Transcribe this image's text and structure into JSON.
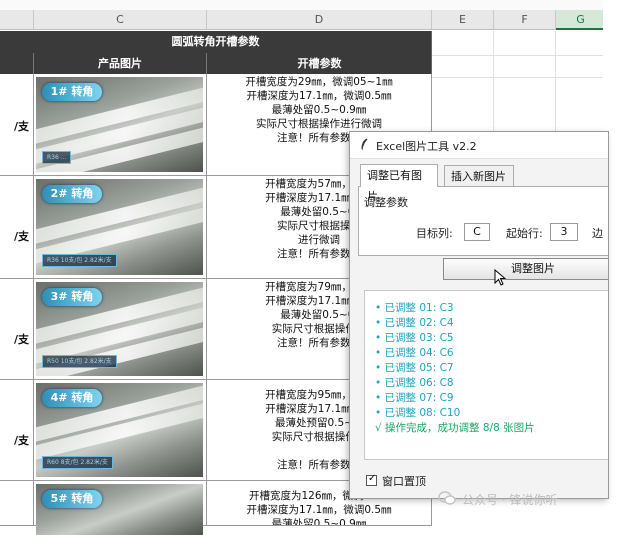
{
  "columns": [
    "C",
    "D",
    "E",
    "F",
    "G"
  ],
  "sheet": {
    "title": "圆弧转角开槽参数",
    "header_image": "产品图片",
    "header_params": "开槽参数",
    "price_suffix": "/支",
    "rows": [
      {
        "badge": "1# 转角",
        "spec": "R36 ...",
        "params": [
          "开槽宽度为29㎜，微调05~1㎜",
          "开槽深度为17.1㎜，微调0.5㎜",
          "最薄处留0.5~0.9㎜",
          "实际尺寸根据操作进行微调",
          "注意！所有参数仅"
        ]
      },
      {
        "badge": "2# 转角",
        "spec": "R36   10支/包  2.82米/支",
        "params": [
          "开槽宽度为57㎜，微调",
          "开槽深度为17.1㎜，微",
          "最薄处留0.5~0.",
          "实际尺寸根据操作",
          "进行微调",
          "注意！所有参数仅"
        ]
      },
      {
        "badge": "3# 转角",
        "spec": "R50   10支/包  2.82米/支",
        "params": [
          "开槽宽度为79㎜，微调",
          "开槽深度为17.1㎜，微",
          "最薄处留0.5~0.",
          "实际尺寸根据操作进",
          "注意！所有参数仅"
        ]
      },
      {
        "badge": "4# 转角",
        "spec": "R60   8支/包  2.82米/支",
        "params": [
          "开槽宽度为95㎜，微调",
          "开槽深度为17.1㎜，微",
          "最薄处预留0.5~0.",
          "实际尺寸根据操作进",
          "",
          "注意！所有参数仅"
        ]
      },
      {
        "badge": "5# 转角",
        "spec": "",
        "params": [
          "开槽宽度为126㎜，微调0.5~",
          "开槽深度为17.1㎜，微调0.5㎜",
          "最薄处留0.5~0.9㎜"
        ]
      }
    ]
  },
  "dialog": {
    "title": "Excel图片工具 v2.2",
    "tabs": [
      "调整已有图片",
      "插入新图片"
    ],
    "group_label": "调整参数",
    "target_col_label": "目标列:",
    "target_col_value": "C",
    "start_row_label": "起始行:",
    "start_row_value": "3",
    "extra_label": "边",
    "button_label": "调整图片",
    "log": [
      "• 已调整 01: C3",
      "• 已调整 02: C4",
      "• 已调整 03: C5",
      "• 已调整 04: C6",
      "• 已调整 05: C7",
      "• 已调整 06: C8",
      "• 已调整 07: C9",
      "• 已调整 08: C10"
    ],
    "log_success": "√ 操作完成，成功调整 8/8 张图片",
    "topmost_label": "窗口置顶",
    "topmost_checked": true
  },
  "watermark": "公众号 · 锋说你听"
}
